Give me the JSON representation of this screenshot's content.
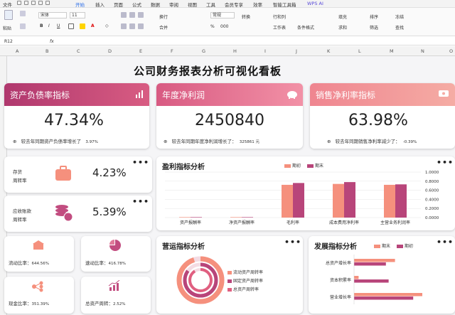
{
  "menu": [
    "文件",
    "开始",
    "插入",
    "页面",
    "公式",
    "数据",
    "审阅",
    "视图",
    "工具",
    "会员专享",
    "效率",
    "智能工具箱",
    "WPS AI"
  ],
  "ribbon": {
    "font_name": "宋体",
    "font_size": "11",
    "number_format": "常规",
    "wrap": "换行",
    "merge": "合并",
    "convert": "转换",
    "rows_cols": "行和列",
    "worksheet": "工作表",
    "cond_format": "条件格式",
    "fill": "填充",
    "sum": "求和",
    "sort": "排序",
    "filter": "筛选",
    "find": "查找",
    "paste": "粘贴",
    "freeze": "冻结"
  },
  "cell_ref": "R12",
  "fx": "fx",
  "columns": [
    "A",
    "B",
    "C",
    "D",
    "E",
    "F",
    "G",
    "H",
    "I",
    "J",
    "K",
    "L",
    "M",
    "N",
    "O"
  ],
  "dashboard": {
    "title": "公司财务报表分析可视化看板",
    "kpis": [
      {
        "title": "资产负债率指标",
        "value": "47.34%",
        "note": "较去年同期资产负债率增长了",
        "delta": "3.97%",
        "color1": "#b0386e",
        "color2": "#e86a86",
        "icon": "bar-chart-icon"
      },
      {
        "title": "年度净利润",
        "value": "2450840",
        "note": "较去年同期年度净利润增长了：",
        "delta": "325861 元",
        "color1": "#d95b82",
        "color2": "#f08aa0",
        "icon": "piggy-bank-icon"
      },
      {
        "title": "销售净利率指标",
        "value": "63.98%",
        "note": "较去年同期销售净利率减少了：",
        "delta": "-0.39%",
        "color1": "#f08a8f",
        "color2": "#f7b0a8",
        "icon": "money-stack-icon"
      }
    ],
    "turnover": [
      {
        "label1": "存货",
        "label2": "周转率",
        "value": "4.23%",
        "icon": "suitcase-icon"
      },
      {
        "label1": "应收账款",
        "label2": "周转率",
        "value": "5.39%",
        "icon": "coins-icon"
      }
    ],
    "small": [
      {
        "label": "流动比率：",
        "value": "644.56%",
        "icon": "shop-icon"
      },
      {
        "label": "速动比率：",
        "value": "416.78%",
        "icon": "pie-icon"
      },
      {
        "label": "现金比率：",
        "value": "351.39%",
        "icon": "network-icon"
      },
      {
        "label": "总资产周转：",
        "value": "2.52%",
        "icon": "growth-icon"
      }
    ],
    "profit_chart": {
      "title": "盈利指标分析",
      "legend": [
        "期初",
        "期末"
      ]
    },
    "ops_chart": {
      "title": "营运指标分析",
      "legend": [
        "流动资产周转率",
        "固定资产周转率",
        "总资产周转率"
      ]
    },
    "dev_chart": {
      "title": "发展指标分析",
      "legend": [
        "期末",
        "期初"
      ]
    }
  },
  "chart_data": [
    {
      "type": "bar",
      "title": "盈利指标分析",
      "categories": [
        "资产报酬率",
        "净资产报酬率",
        "毛利率",
        "成本费用净利率",
        "主营业务利润率"
      ],
      "series": [
        {
          "name": "期初",
          "values": [
            0.01,
            0.01,
            0.72,
            0.74,
            0.72
          ],
          "color": "#f5907d"
        },
        {
          "name": "期末",
          "values": [
            0.01,
            0.01,
            0.76,
            0.78,
            0.73
          ],
          "color": "#b8457a"
        }
      ],
      "ylim": [
        0,
        1
      ],
      "yticks": [
        "0.0000",
        "0.2000",
        "0.4000",
        "0.6000",
        "0.8000",
        "1.0000"
      ]
    },
    {
      "type": "pie",
      "title": "营运指标分析",
      "labels": [
        "流动资产周转率",
        "固定资产周转率",
        "总资产周转率"
      ],
      "values": [
        45,
        25,
        30
      ],
      "colors": [
        "#f5907d",
        "#b8457a",
        "#e05f80"
      ]
    },
    {
      "type": "bar",
      "title": "发展指标分析",
      "categories": [
        "总资产增长率",
        "资本积累率",
        "营业增长率"
      ],
      "series": [
        {
          "name": "期末",
          "values": [
            0.45,
            0.05,
            0.75
          ],
          "color": "#f5907d"
        },
        {
          "name": "期初",
          "values": [
            0.35,
            0.38,
            0.65
          ],
          "color": "#b8457a"
        }
      ],
      "orientation": "horizontal"
    }
  ]
}
